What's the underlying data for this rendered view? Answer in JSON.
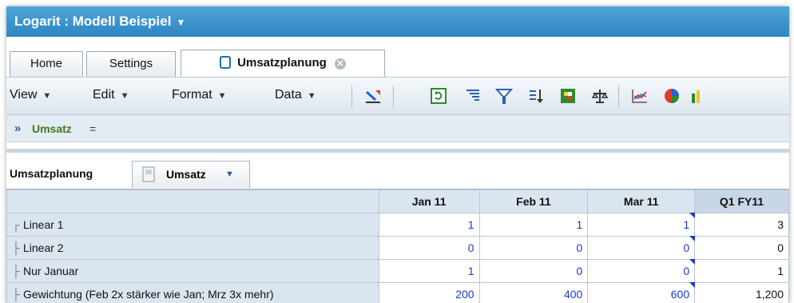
{
  "app": {
    "title": "Logarit : Modell Beispiel"
  },
  "tabs": [
    {
      "label": "Home"
    },
    {
      "label": "Settings"
    },
    {
      "label": "Umsatzplanung"
    }
  ],
  "toolbar": {
    "menus": [
      "View",
      "Edit",
      "Format",
      "Data"
    ],
    "icons": [
      "chart-edit-icon",
      "refresh-icon",
      "align-icon",
      "filter-icon",
      "sort-icon",
      "color-grid-icon",
      "balance-icon",
      "line-chart-icon",
      "pie-chart-icon",
      "bar-chart-icon"
    ]
  },
  "formula": {
    "name": "Umsatz",
    "equals": "="
  },
  "sheet": {
    "label": "Umsatzplanung",
    "view_tab": "Umsatz"
  },
  "table": {
    "columns": [
      "Jan 11",
      "Feb 11",
      "Mar 11",
      "Q1 FY11"
    ],
    "rows": [
      {
        "label": "Linear 1",
        "jan": "1",
        "feb": "1",
        "mar": "1",
        "q1": "3"
      },
      {
        "label": "Linear 2",
        "jan": "0",
        "feb": "0",
        "mar": "0",
        "q1": "0"
      },
      {
        "label": "Nur Januar",
        "jan": "1",
        "feb": "0",
        "mar": "0",
        "q1": "1"
      },
      {
        "label": "Gewichtung (Feb 2x stärker wie Jan; Mrz 3x mehr)",
        "jan": "200",
        "feb": "400",
        "mar": "600",
        "q1": "1,200"
      }
    ]
  },
  "colors": {
    "title_bar": "#2d86c3",
    "value_text": "#1a3ad0",
    "header_bg": "#dbe5ef"
  }
}
